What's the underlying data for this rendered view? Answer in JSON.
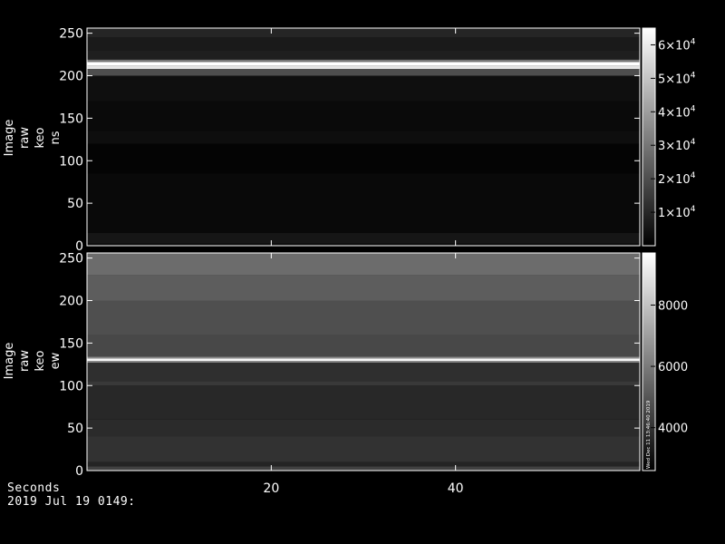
{
  "chart_data": [
    {
      "type": "heatmap",
      "ylabel": [
        "Image",
        "raw",
        "keo",
        "ns"
      ],
      "y_ticks": [
        0,
        50,
        100,
        150,
        200,
        250
      ],
      "ylim": [
        0,
        256
      ],
      "xlim": [
        0,
        60
      ],
      "colorbar": {
        "range": [
          0,
          65000
        ],
        "ticks": [
          {
            "value": 10000,
            "mant": "1",
            "exp": "4"
          },
          {
            "value": 20000,
            "mant": "2",
            "exp": "4"
          },
          {
            "value": 30000,
            "mant": "3",
            "exp": "4"
          },
          {
            "value": 40000,
            "mant": "4",
            "exp": "4"
          },
          {
            "value": 50000,
            "mant": "5",
            "exp": "4"
          },
          {
            "value": 60000,
            "mant": "6",
            "exp": "4"
          }
        ]
      },
      "bands": [
        {
          "y0": 0,
          "y1": 3,
          "value": 4000
        },
        {
          "y0": 3,
          "y1": 15,
          "value": 5500
        },
        {
          "y0": 15,
          "y1": 85,
          "value": 2200
        },
        {
          "y0": 85,
          "y1": 120,
          "value": 1000
        },
        {
          "y0": 120,
          "y1": 135,
          "value": 3500
        },
        {
          "y0": 135,
          "y1": 170,
          "value": 2500
        },
        {
          "y0": 170,
          "y1": 200,
          "value": 3800
        },
        {
          "y0": 200,
          "y1": 208,
          "value": 20000
        },
        {
          "y0": 208,
          "y1": 212,
          "value": 58000
        },
        {
          "y0": 212,
          "y1": 216,
          "value": 65000
        },
        {
          "y0": 216,
          "y1": 219,
          "value": 30000
        },
        {
          "y0": 219,
          "y1": 230,
          "value": 8000
        },
        {
          "y0": 230,
          "y1": 245,
          "value": 6500
        },
        {
          "y0": 245,
          "y1": 256,
          "value": 9500
        }
      ]
    },
    {
      "type": "heatmap",
      "ylabel": [
        "Image",
        "raw",
        "keo",
        "ew"
      ],
      "y_ticks": [
        0,
        50,
        100,
        150,
        200,
        250
      ],
      "ylim": [
        0,
        256
      ],
      "xlim": [
        0,
        60
      ],
      "colorbar": {
        "range": [
          2600,
          9700
        ],
        "ticks": [
          {
            "value": 4000,
            "label": "4000"
          },
          {
            "value": 6000,
            "label": "6000"
          },
          {
            "value": 8000,
            "label": "8000"
          }
        ],
        "side_text": "Wed Dec 11 13:46:40 2019"
      },
      "bands": [
        {
          "y0": 0,
          "y1": 5,
          "value": 4400
        },
        {
          "y0": 5,
          "y1": 10,
          "value": 3600
        },
        {
          "y0": 10,
          "y1": 40,
          "value": 4000
        },
        {
          "y0": 40,
          "y1": 60,
          "value": 3800
        },
        {
          "y0": 60,
          "y1": 100,
          "value": 3700
        },
        {
          "y0": 100,
          "y1": 105,
          "value": 4200
        },
        {
          "y0": 105,
          "y1": 127,
          "value": 3900
        },
        {
          "y0": 127,
          "y1": 129,
          "value": 6500
        },
        {
          "y0": 129,
          "y1": 132,
          "value": 9500
        },
        {
          "y0": 132,
          "y1": 134,
          "value": 6500
        },
        {
          "y0": 134,
          "y1": 160,
          "value": 4600
        },
        {
          "y0": 160,
          "y1": 200,
          "value": 4800
        },
        {
          "y0": 200,
          "y1": 230,
          "value": 5200
        },
        {
          "y0": 230,
          "y1": 256,
          "value": 5600
        }
      ]
    }
  ],
  "x_axis": {
    "ticks": [
      20,
      40
    ],
    "label": "Seconds",
    "date": "2019 Jul 19 0149:"
  }
}
